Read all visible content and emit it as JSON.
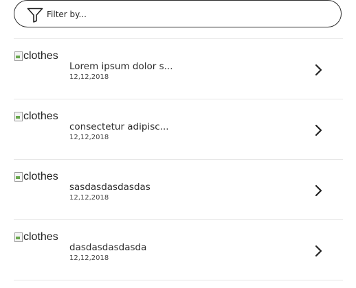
{
  "filter": {
    "placeholder": "Filter by...",
    "icon": "filter-icon"
  },
  "items": [
    {
      "image_alt": "clothes",
      "title": "Lorem ipsum dolor s...",
      "date": "12,12,2018"
    },
    {
      "image_alt": "clothes",
      "title": "consectetur adipisc...",
      "date": "12,12,2018"
    },
    {
      "image_alt": "clothes",
      "title": "sasdasdasdasdas",
      "date": "12,12,2018"
    },
    {
      "image_alt": "clothes",
      "title": "dasdasdasdasda",
      "date": "12,12,2018"
    }
  ],
  "colors": {
    "border": "#2b2b2b",
    "divider": "#e6e6e6",
    "text": "#222222"
  }
}
